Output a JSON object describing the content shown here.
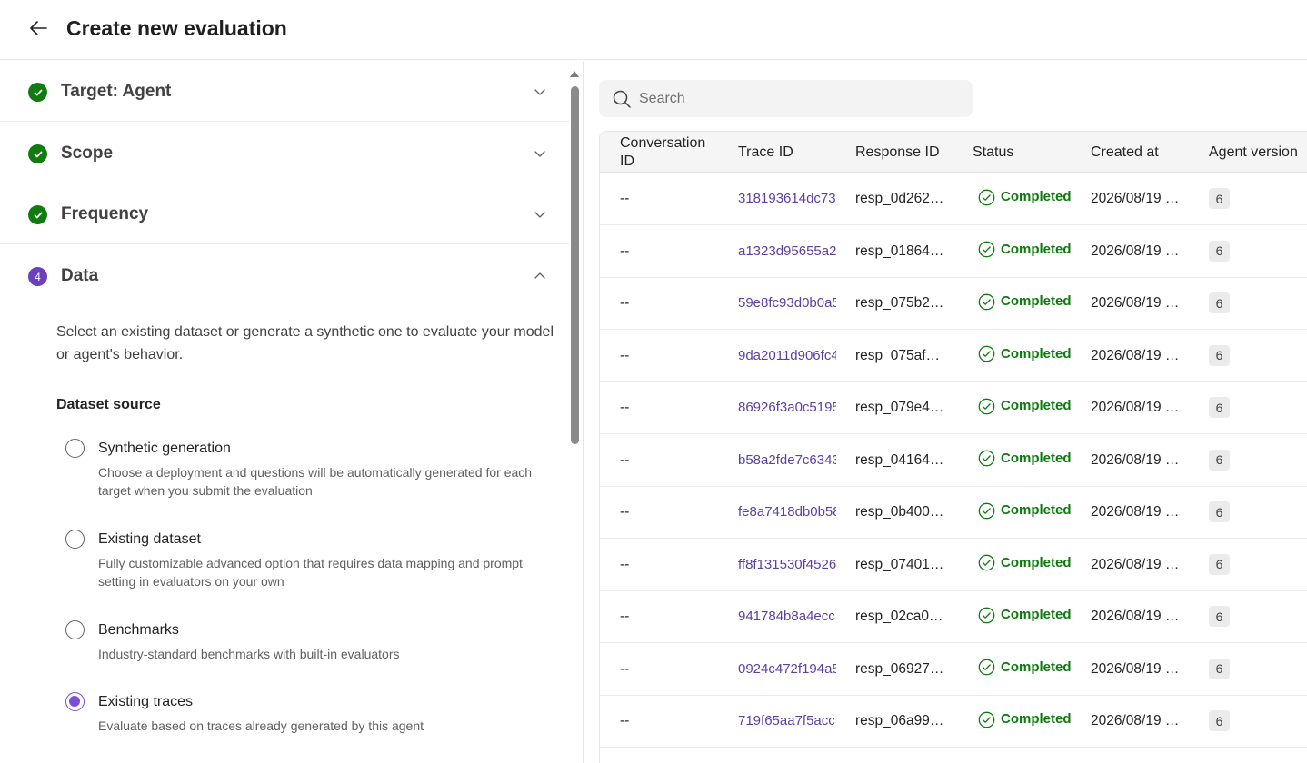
{
  "header": {
    "title": "Create new evaluation"
  },
  "steps": [
    {
      "label": "Target: Agent",
      "state": "complete"
    },
    {
      "label": "Scope",
      "state": "complete"
    },
    {
      "label": "Frequency",
      "state": "complete"
    },
    {
      "label": "Data",
      "state": "active",
      "number": "4"
    }
  ],
  "data_step": {
    "description": "Select an existing dataset or generate a synthetic one to evaluate your model or agent's behavior.",
    "section_label": "Dataset source",
    "options": [
      {
        "title": "Synthetic generation",
        "desc": "Choose a deployment and questions will be automatically generated for each target when you submit the evaluation",
        "checked": false
      },
      {
        "title": "Existing dataset",
        "desc": "Fully customizable advanced option that requires data mapping and prompt setting in evaluators on your own",
        "checked": false
      },
      {
        "title": "Benchmarks",
        "desc": "Industry-standard benchmarks with built-in evaluators",
        "checked": false
      },
      {
        "title": "Existing traces",
        "desc": "Evaluate based on traces already generated by this agent",
        "checked": true
      }
    ]
  },
  "search": {
    "placeholder": "Search"
  },
  "table": {
    "columns": {
      "conversation_line1": "Conversation",
      "conversation_line2": "ID",
      "trace": "Trace ID",
      "response": "Response ID",
      "status": "Status",
      "created": "Created at",
      "version": "Agent version"
    },
    "rows": [
      {
        "conv": "--",
        "trace": "318193614dc73",
        "resp": "resp_0d262…",
        "status": "Completed",
        "created": "2026/08/19 …",
        "version": "6"
      },
      {
        "conv": "--",
        "trace": "a1323d95655a2",
        "resp": "resp_01864…",
        "status": "Completed",
        "created": "2026/08/19 …",
        "version": "6"
      },
      {
        "conv": "--",
        "trace": "59e8fc93d0b0a5",
        "resp": "resp_075b2…",
        "status": "Completed",
        "created": "2026/08/19 …",
        "version": "6"
      },
      {
        "conv": "--",
        "trace": "9da2011d906fc4",
        "resp": "resp_075af…",
        "status": "Completed",
        "created": "2026/08/19 …",
        "version": "6"
      },
      {
        "conv": "--",
        "trace": "86926f3a0c5195",
        "resp": "resp_079e4…",
        "status": "Completed",
        "created": "2026/08/19 …",
        "version": "6"
      },
      {
        "conv": "--",
        "trace": "b58a2fde7c6343",
        "resp": "resp_04164…",
        "status": "Completed",
        "created": "2026/08/19 …",
        "version": "6"
      },
      {
        "conv": "--",
        "trace": "fe8a7418db0b58",
        "resp": "resp_0b400…",
        "status": "Completed",
        "created": "2026/08/19 …",
        "version": "6"
      },
      {
        "conv": "--",
        "trace": "ff8f131530f4526",
        "resp": "resp_07401…",
        "status": "Completed",
        "created": "2026/08/19 …",
        "version": "6"
      },
      {
        "conv": "--",
        "trace": "941784b8a4ecc",
        "resp": "resp_02ca0…",
        "status": "Completed",
        "created": "2026/08/19 …",
        "version": "6"
      },
      {
        "conv": "--",
        "trace": "0924c472f194a5",
        "resp": "resp_06927…",
        "status": "Completed",
        "created": "2026/08/19 …",
        "version": "6"
      },
      {
        "conv": "--",
        "trace": "719f65aa7f5acc",
        "resp": "resp_06a99…",
        "status": "Completed",
        "created": "2026/08/19 …",
        "version": "6"
      }
    ]
  },
  "colors": {
    "complete": "#107c10",
    "accent": "#7b4fd4",
    "link": "#5b3fa5"
  }
}
